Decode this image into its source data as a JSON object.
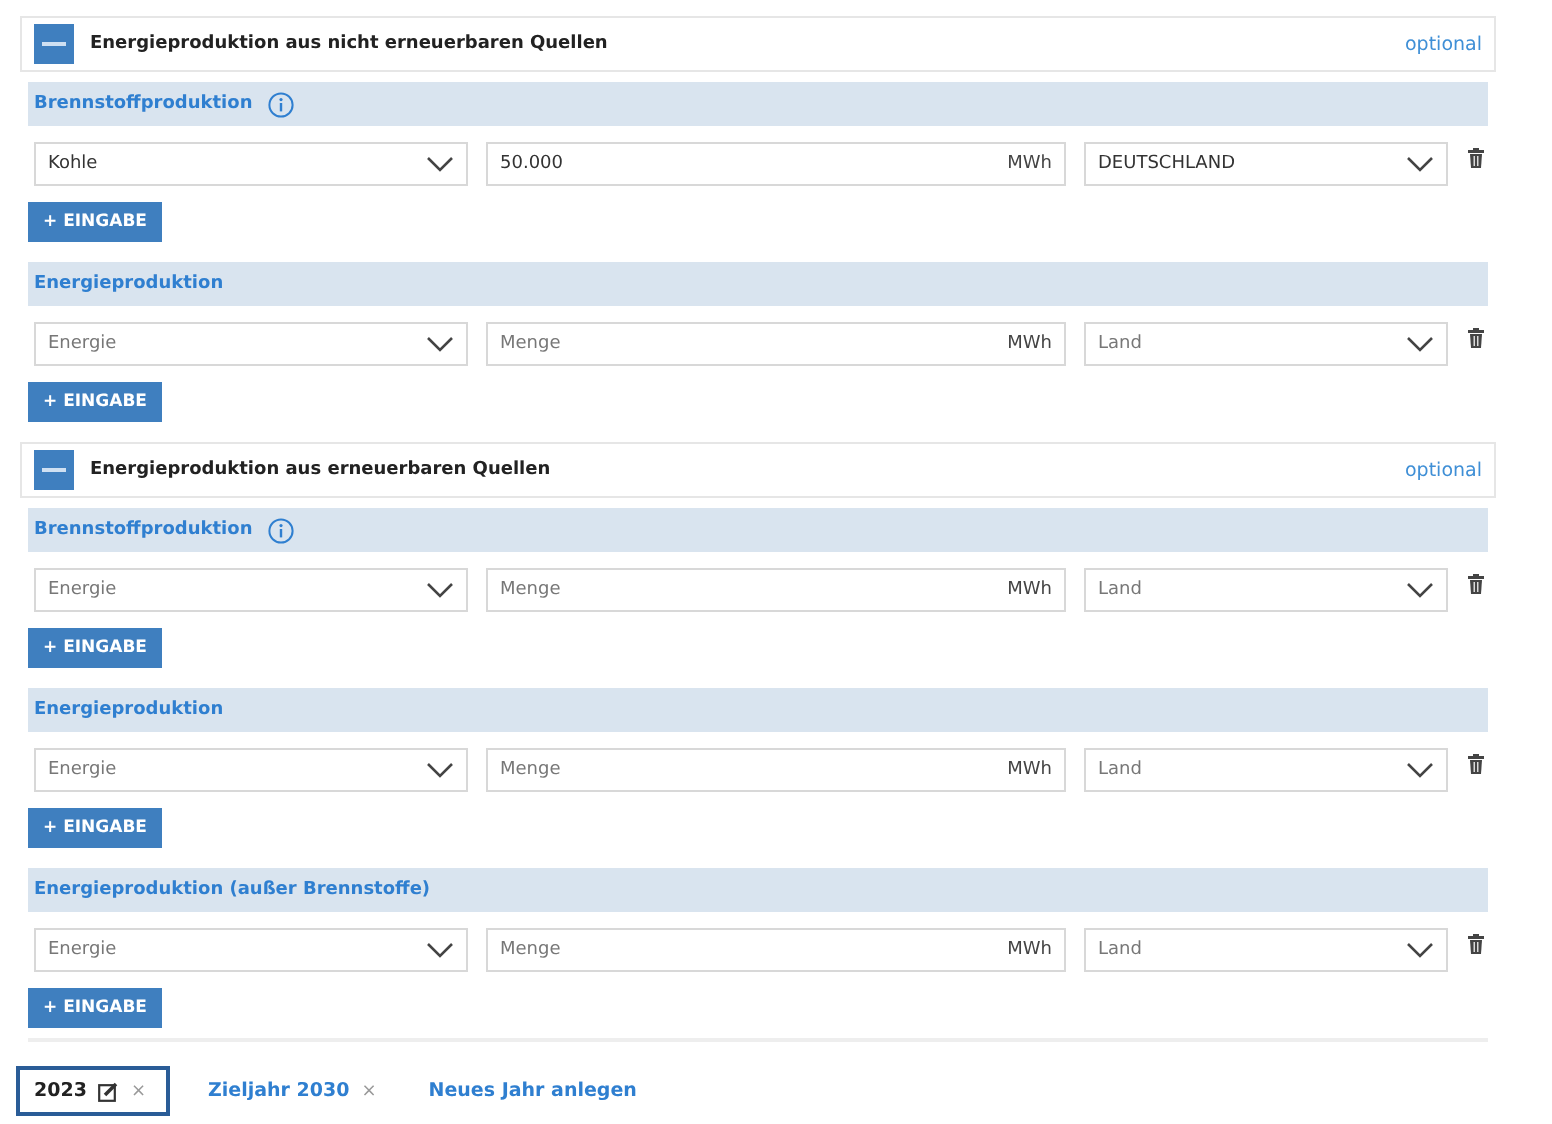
{
  "sections": [
    {
      "title": "Energieproduktion aus nicht erneuerbaren Quellen",
      "expanded": true,
      "badge": "optional",
      "groups": [
        {
          "title": "Brennstoffproduktion",
          "info": true,
          "rows": [
            {
              "type": {
                "value": "Kohle"
              },
              "amount": {
                "value": "50.000"
              },
              "unit": "MWh",
              "country": {
                "value": "DEUTSCHLAND"
              }
            }
          ],
          "add_label": "+ EINGABE"
        },
        {
          "title": "Energieproduktion",
          "info": false,
          "rows": [
            {
              "type": {
                "placeholder": "Energie"
              },
              "amount": {
                "placeholder": "Menge"
              },
              "unit": "MWh",
              "country": {
                "placeholder": "Land"
              }
            }
          ],
          "add_label": "+ EINGABE"
        }
      ]
    },
    {
      "title": "Energieproduktion aus erneuerbaren Quellen",
      "expanded": true,
      "badge": "optional",
      "groups": [
        {
          "title": "Brennstoffproduktion",
          "info": true,
          "rows": [
            {
              "type": {
                "placeholder": "Energie"
              },
              "amount": {
                "placeholder": "Menge"
              },
              "unit": "MWh",
              "country": {
                "placeholder": "Land"
              }
            }
          ],
          "add_label": "+ EINGABE"
        },
        {
          "title": "Energieproduktion",
          "info": false,
          "rows": [
            {
              "type": {
                "placeholder": "Energie"
              },
              "amount": {
                "placeholder": "Menge"
              },
              "unit": "MWh",
              "country": {
                "placeholder": "Land"
              }
            }
          ],
          "add_label": "+ EINGABE"
        },
        {
          "title": "Energieproduktion (außer Brennstoffe)",
          "info": false,
          "rows": [
            {
              "type": {
                "placeholder": "Energie"
              },
              "amount": {
                "placeholder": "Menge"
              },
              "unit": "MWh",
              "country": {
                "placeholder": "Land"
              }
            }
          ],
          "add_label": "+ EINGABE"
        }
      ]
    }
  ],
  "year_tabs": [
    {
      "label": "2023",
      "selected": true,
      "editable": true,
      "close": "×"
    },
    {
      "label": "Zieljahr 2030",
      "selected": false,
      "editable": false,
      "close": "×"
    }
  ],
  "new_year_link": "Neues Jahr anlegen"
}
